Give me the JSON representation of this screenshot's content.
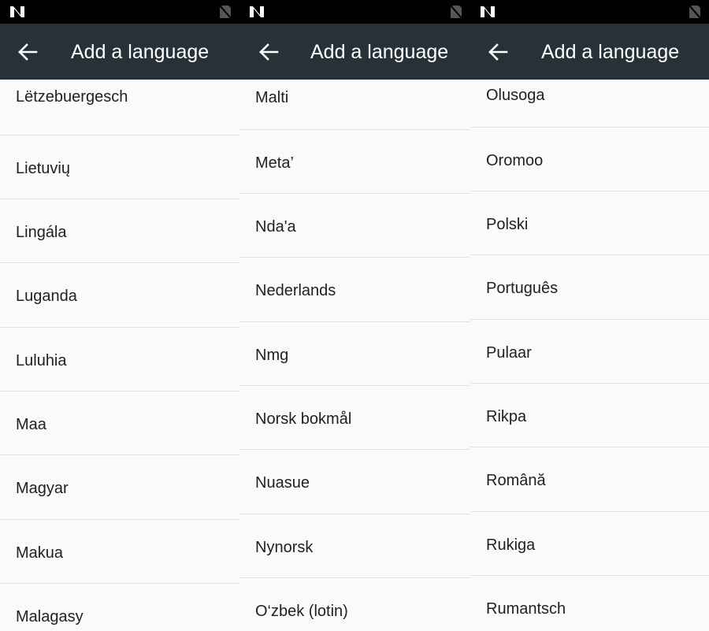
{
  "status_bar": {
    "left_icon": "n-logo-icon",
    "right_icon": "no-sim-icon"
  },
  "colors": {
    "app_bar": "#263238",
    "status_bar": "#000000",
    "background": "#fafafa",
    "divider": "#e0e0e0",
    "text": "#212121"
  },
  "panels": [
    {
      "title": "Add a language",
      "items": [
        "Lëtzebuergesch",
        "Lietuvių",
        "Lingála",
        "Luganda",
        "Luluhia",
        "Maa",
        "Magyar",
        "Makua",
        "Malagasy"
      ]
    },
    {
      "title": "Add a language",
      "items": [
        "Malti",
        "Meta’",
        "Nda'a",
        "Nederlands",
        "Nmg",
        "Norsk bokmål",
        "Nuasue",
        "Nynorsk",
        "O‘zbek (lotin)"
      ]
    },
    {
      "title": "Add a language",
      "items": [
        "Olusoga",
        "Oromoo",
        "Polski",
        "Português",
        "Pulaar",
        "Rikpa",
        "Română",
        "Rukiga",
        "Rumantsch"
      ]
    }
  ]
}
